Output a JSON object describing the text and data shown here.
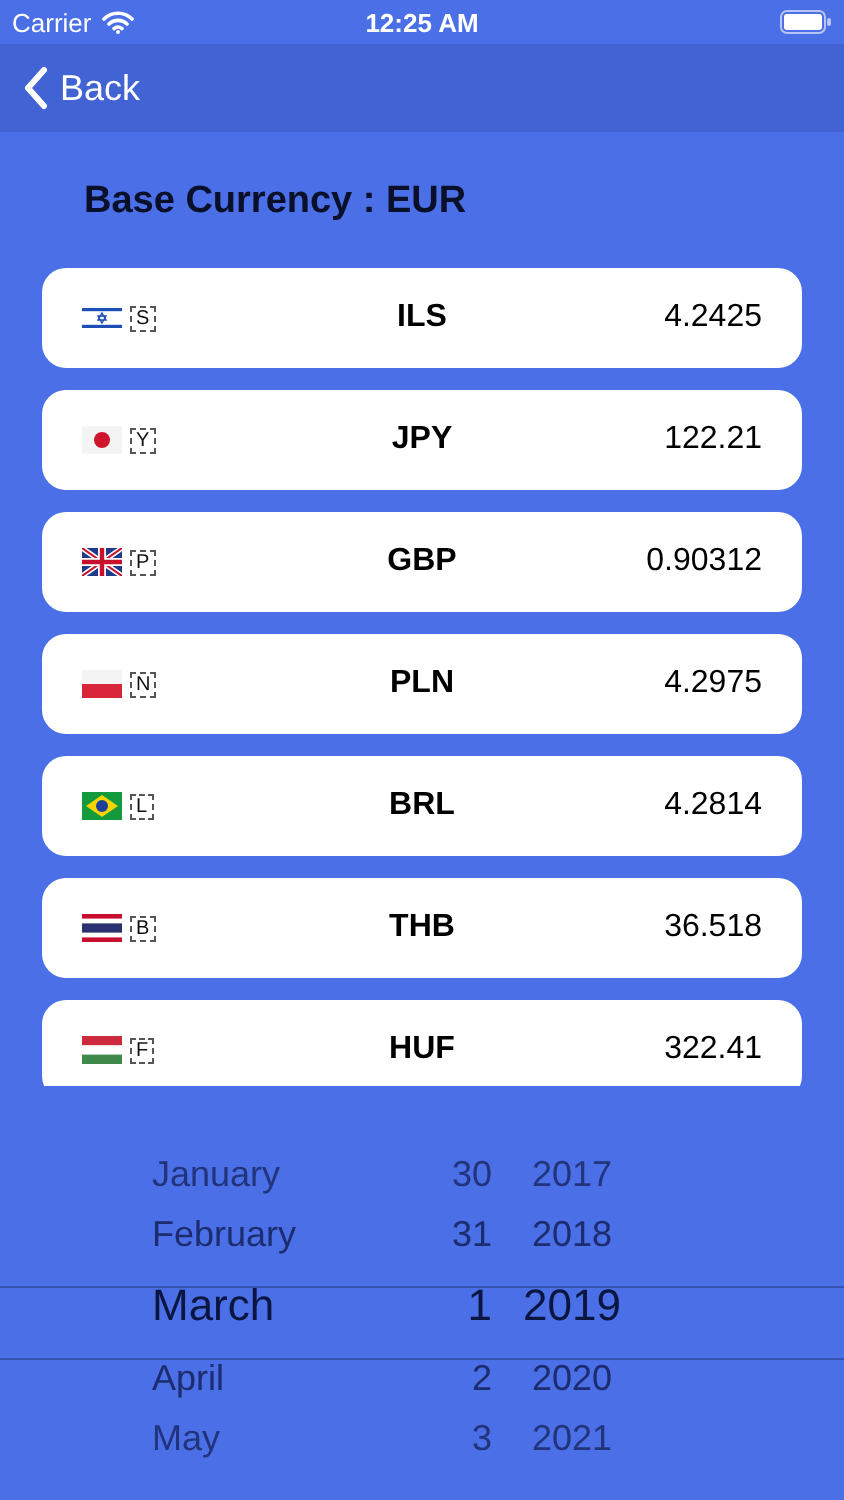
{
  "status_bar": {
    "carrier": "Carrier",
    "time": "12:25 AM"
  },
  "nav": {
    "back": "Back"
  },
  "title": "Base Currency : EUR",
  "rates": [
    {
      "symbol": "S",
      "code": "ILS",
      "rate": "4.2425"
    },
    {
      "symbol": "Y",
      "code": "JPY",
      "rate": "122.21"
    },
    {
      "symbol": "P",
      "code": "GBP",
      "rate": "0.90312"
    },
    {
      "symbol": "N",
      "code": "PLN",
      "rate": "4.2975"
    },
    {
      "symbol": "L",
      "code": "BRL",
      "rate": "4.2814"
    },
    {
      "symbol": "B",
      "code": "THB",
      "rate": "36.518"
    },
    {
      "symbol": "F",
      "code": "HUF",
      "rate": "322.41"
    }
  ],
  "date_picker": {
    "rows": [
      {
        "month": "January",
        "day": "30",
        "year": "2017",
        "selected": false
      },
      {
        "month": "February",
        "day": "31",
        "year": "2018",
        "selected": false
      },
      {
        "month": "March",
        "day": "1",
        "year": "2019",
        "selected": true
      },
      {
        "month": "April",
        "day": "2",
        "year": "2020",
        "selected": false
      },
      {
        "month": "May",
        "day": "3",
        "year": "2021",
        "selected": false
      }
    ]
  }
}
